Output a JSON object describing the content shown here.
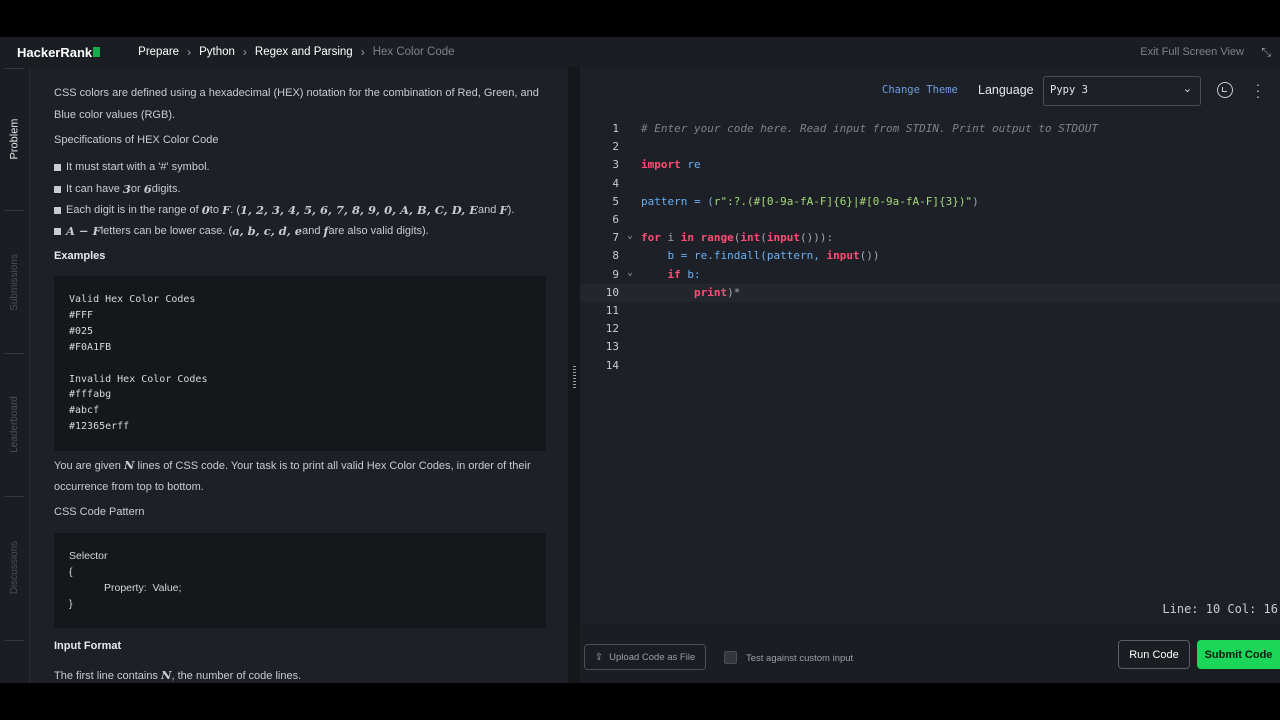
{
  "topbar": {
    "logo": "HackerRank",
    "breadcrumbs": [
      "Prepare",
      "Python",
      "Regex and Parsing",
      "Hex Color Code"
    ],
    "exit_fullscreen": "Exit Full Screen View"
  },
  "siderail": {
    "tabs": [
      "Problem",
      "Submissions",
      "Leaderboard",
      "Discussions"
    ]
  },
  "problem": {
    "intro_1": "CSS colors are defined using a hexadecimal (HEX) notation for the combination of Red, Green, and",
    "intro_2": "Blue color values (RGB).",
    "spec_heading": "Specifications of HEX Color Code",
    "bullet_1": "It must start with a '#' symbol.",
    "bullet_2_a": "It can have ",
    "bullet_2_m1": "3",
    "bullet_2_b": " or ",
    "bullet_2_m2": "6",
    "bullet_2_c": " digits.",
    "bullet_3_a": "Each digit is in the range of ",
    "bullet_3_m1": "0",
    "bullet_3_b": " to ",
    "bullet_3_m2": "F",
    "bullet_3_c": ". (",
    "bullet_3_m3": "1, 2, 3, 4, 5, 6, 7, 8, 9, 0, A, B, C, D, E",
    "bullet_3_d": " and ",
    "bullet_3_m4": "F",
    "bullet_3_e": ").",
    "bullet_4_m1": "A − F",
    "bullet_4_a": " letters can be lower case. (",
    "bullet_4_m2": "a, b, c, d, e",
    "bullet_4_b": " and ",
    "bullet_4_m3": "f",
    "bullet_4_c": " are also valid digits).",
    "examples_heading": "Examples",
    "examples_code": "Valid Hex Color Codes\n#FFF\n#025\n#F0A1FB\n\nInvalid Hex Color Codes\n#fffabg\n#abcf\n#12365erff",
    "given_a": "You are given ",
    "given_m": "N",
    "given_b": " lines of CSS code. Your task is to print all valid Hex Color Codes, in order of their",
    "given_2": "occurrence from top to bottom.",
    "pattern_heading": "CSS Code Pattern",
    "pattern_code": "Selector\n{\n            Property:  Value;\n}",
    "input_heading": "Input Format",
    "input_a": "The first line contains ",
    "input_m": "N",
    "input_b": ", the number of code lines."
  },
  "editor": {
    "change_theme": "Change Theme",
    "language_label": "Language",
    "language_value": "Pypy 3",
    "icons": [
      "reset-icon",
      "more-options-icon",
      "chevron-down-icon"
    ],
    "line_numbers": [
      "1",
      "2",
      "3",
      "4",
      "5",
      "6",
      "7",
      "8",
      "9",
      "10",
      "11",
      "12",
      "13",
      "14"
    ],
    "lines": {
      "l1": "# Enter your code here. Read input from STDIN. Print output to STDOUT",
      "l3_kw": "import",
      "l3_rest": " re",
      "l5_a": "pattern = (",
      "l5_str": "r\":?.(#[0-9a-fA-F]{6}|#[0-9a-fA-F]{3})\"",
      "l5_b": ")",
      "l7_kw1": "for",
      "l7_a": " i ",
      "l7_kw2": "in",
      "l7_sp": " ",
      "l7_fn1": "range",
      "l7_p1": "(",
      "l7_fn2": "int",
      "l7_p2": "(",
      "l7_fn3": "input",
      "l7_b": "())):",
      "l8_a": "    b = re.",
      "l8_fn": "findall",
      "l8_b": "(pattern, ",
      "l8_fn2": "input",
      "l8_c": "())",
      "l9_kw": "    if",
      "l9_b": " b:",
      "l10_fn": "        print",
      "l10_b": ")*"
    },
    "cursor_position": "Line: 10 Col: 16"
  },
  "footer": {
    "upload": "Upload Code as File",
    "custom_input": "Test against custom input",
    "run": "Run Code",
    "submit": "Submit Code"
  },
  "colors": {
    "accent_green": "#1cd65a",
    "keyword": "#ff4d74",
    "string": "#a3d97a",
    "function": "#6ab0f3"
  }
}
